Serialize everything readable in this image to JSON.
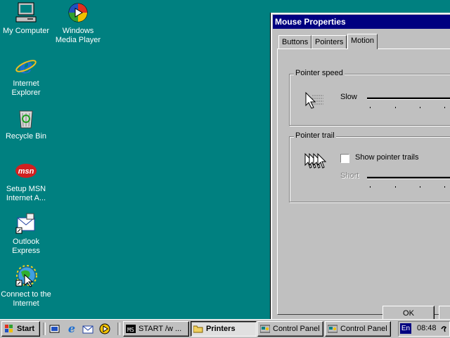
{
  "desktop": {
    "icons": [
      {
        "name": "my-computer",
        "label_lines": [
          "My Computer"
        ]
      },
      {
        "name": "windows-media-player",
        "label_lines": [
          "Windows",
          "Media Player"
        ]
      },
      {
        "name": "internet-explorer",
        "label_lines": [
          "Internet",
          "Explorer"
        ]
      },
      {
        "name": "recycle-bin",
        "label_lines": [
          "Recycle Bin"
        ]
      },
      {
        "name": "setup-msn",
        "label_lines": [
          "Setup MSN",
          "Internet A..."
        ]
      },
      {
        "name": "outlook-express",
        "label_lines": [
          "Outlook",
          "Express"
        ]
      },
      {
        "name": "connect-internet",
        "label_lines": [
          "Connect to the",
          "Internet"
        ]
      }
    ],
    "msn_logo_text": "msn"
  },
  "dialog": {
    "title": "Mouse Properties",
    "tabs": [
      "Buttons",
      "Pointers",
      "Motion"
    ],
    "active_tab": "Motion",
    "pointer_speed": {
      "group_title": "Pointer speed",
      "slider_label": "Slow"
    },
    "pointer_trail": {
      "group_title": "Pointer trail",
      "checkbox_label": "Show pointer trails",
      "checked": false,
      "slider_label": "Short"
    },
    "ok_label": "OK"
  },
  "taskbar": {
    "start_label": "Start",
    "buttons": [
      {
        "label": "START /w ...",
        "icon": "ms-dos-icon"
      },
      {
        "label": "Printers",
        "icon": "folder-icon",
        "active": true
      },
      {
        "label": "Control Panel",
        "icon": "control-panel-icon"
      },
      {
        "label": "Control Panel",
        "icon": "control-panel-icon"
      }
    ],
    "tray": {
      "language": "En",
      "time": "08:48"
    }
  },
  "colors": {
    "desktop": "#008080",
    "titlebar": "#000080",
    "face": "#c0c0c0"
  }
}
